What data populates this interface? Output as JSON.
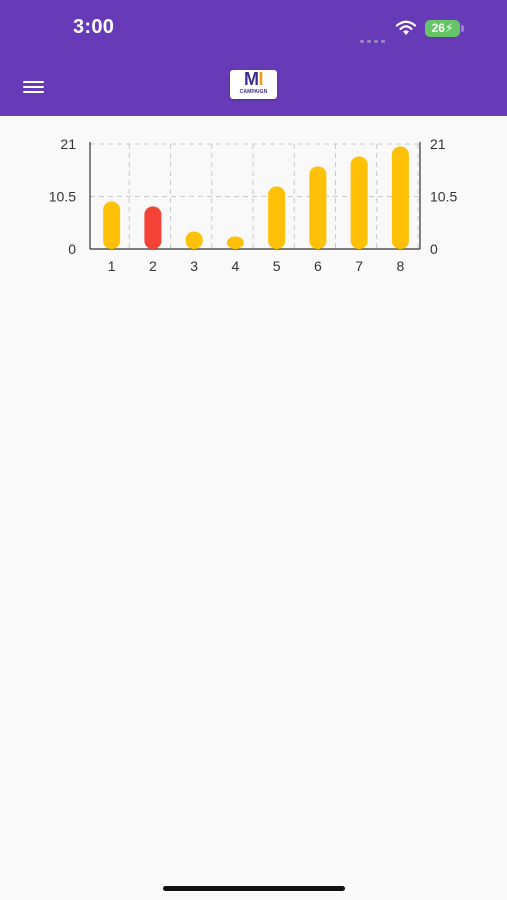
{
  "status_bar": {
    "time": "3:00",
    "battery_level": "26",
    "icons": [
      "cellular-signal-icon",
      "wifi-icon",
      "battery-charging-icon"
    ]
  },
  "app_bar": {
    "background_color": "#673ab7",
    "menu_icon": "hamburger-menu-icon",
    "logo": {
      "letters_main": "M",
      "letters_accent": "I",
      "tagline": "CAMPAIGN"
    }
  },
  "chart_data": {
    "type": "bar",
    "categories": [
      "1",
      "2",
      "3",
      "4",
      "5",
      "6",
      "7",
      "8"
    ],
    "values": [
      9.5,
      8.5,
      3.5,
      2.5,
      12.5,
      16.5,
      18.5,
      20.5
    ],
    "bar_colors": [
      "#ffc107",
      "#f44336",
      "#ffc107",
      "#ffc107",
      "#ffc107",
      "#ffc107",
      "#ffc107",
      "#ffc107"
    ],
    "y_ticks": [
      "0",
      "10.5",
      "21"
    ],
    "ylim": [
      0,
      21
    ],
    "grid": true,
    "right_axis": true
  }
}
